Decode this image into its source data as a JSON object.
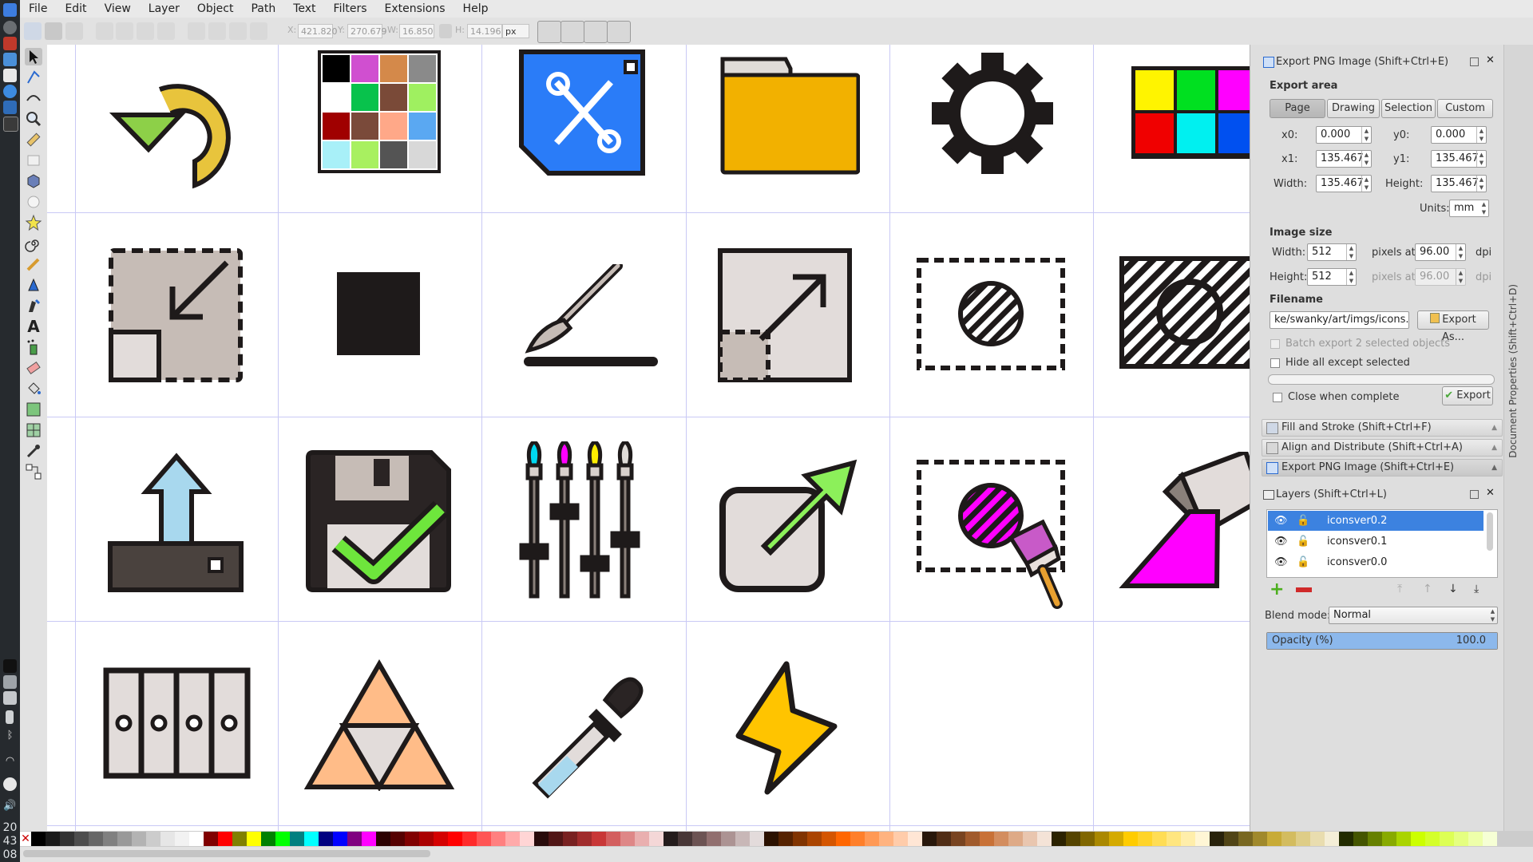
{
  "clock": {
    "line1": "20",
    "line2": "43",
    "line3": "08"
  },
  "menu": [
    "File",
    "Edit",
    "View",
    "Layer",
    "Object",
    "Path",
    "Text",
    "Filters",
    "Extensions",
    "Help"
  ],
  "toolbar": {
    "x_label": "X:",
    "x_value": "421.820",
    "y_label": "Y:",
    "y_value": "270.679",
    "w_label": "W:",
    "w_value": "16.850",
    "h_label": "H:",
    "h_value": "14.196",
    "unit": "px"
  },
  "tools": [
    "selector-tool",
    "node-tool",
    "tweak-tool",
    "zoom-tool",
    "measure-tool",
    "rectangle-tool",
    "3d-box-tool",
    "ellipse-tool",
    "star-tool",
    "spiral-tool",
    "pencil-tool",
    "pen-tool",
    "calligraphy-tool",
    "text-tool",
    "spray-tool",
    "eraser-tool",
    "paint-bucket-tool",
    "gradient-tool",
    "mesh-tool",
    "dropper-tool",
    "connector-tool"
  ],
  "canvas": {
    "icons": [
      "undo-arrow-icon",
      "swatch-grid-icon",
      "tools-document-icon",
      "folder-icon",
      "gear-icon",
      "color-palette-icon",
      "scale-down-icon",
      "filled-square-icon",
      "paintbrush-line-icon",
      "scale-up-icon",
      "hatched-selection-icon",
      "hatched-rectangle-icon",
      "upload-tray-icon",
      "save-check-icon",
      "brush-sliders-icon",
      "external-link-icon",
      "paint-selection-icon",
      "paint-bucket-pour-icon",
      "columns-icon",
      "triangle-icon",
      "eyedropper-icon",
      "lightning-icon"
    ]
  },
  "export": {
    "title": "Export PNG Image (Shift+Ctrl+E)",
    "area_heading": "Export area",
    "area_buttons": [
      "Page",
      "Drawing",
      "Selection",
      "Custom"
    ],
    "active_area": "Page",
    "x0_label": "x0:",
    "x0": "0.000",
    "y0_label": "y0:",
    "y0": "0.000",
    "x1_label": "x1:",
    "x1": "135.467",
    "y1_label": "y1:",
    "y1": "135.467",
    "width_label": "Width:",
    "width": "135.467",
    "height_label": "Height:",
    "height": "135.467",
    "units_label": "Units:",
    "units": "mm",
    "image_size_heading": "Image size",
    "img_width_label": "Width:",
    "img_width": "512",
    "img_height_label": "Height:",
    "img_height": "512",
    "pixels_at": "pixels at",
    "dpi_x": "96.00",
    "dpi_y": "96.00",
    "dpi_unit": "dpi",
    "filename_heading": "Filename",
    "filename": "ke/swanky/art/imgs/icons.png",
    "export_as": "Export As...",
    "batch_label": "Batch export 2 selected objects",
    "hide_label": "Hide all except selected",
    "close_label": "Close when complete",
    "export_button": "Export"
  },
  "dock_expanders": [
    "Fill and Stroke (Shift+Ctrl+F)",
    "Align and Distribute (Shift+Ctrl+A)",
    "Export PNG Image (Shift+Ctrl+E)"
  ],
  "layers": {
    "title": "Layers (Shift+Ctrl+L)",
    "items": [
      "iconsver0.2",
      "iconsver0.1",
      "iconsver0.0"
    ],
    "selected": "iconsver0.2",
    "blend_label": "Blend mode:",
    "blend_value": "Normal",
    "opacity_label": "Opacity (%)",
    "opacity_value": "100.0",
    "opacity_fraction": 1.0
  },
  "side_tab": "Document Properties (Shift+Ctrl+D)",
  "palette_colors": [
    "#000000",
    "#1a1a1a",
    "#333333",
    "#4d4d4d",
    "#666666",
    "#808080",
    "#999999",
    "#b3b3b3",
    "#cccccc",
    "#e6e6e6",
    "#f2f2f2",
    "#ffffff",
    "#800000",
    "#ff0000",
    "#808000",
    "#ffff00",
    "#008000",
    "#00ff00",
    "#008080",
    "#00ffff",
    "#000080",
    "#0000ff",
    "#800080",
    "#ff00ff",
    "#2b0000",
    "#550000",
    "#800000",
    "#aa0000",
    "#d40000",
    "#ff0000",
    "#ff2a2a",
    "#ff5555",
    "#ff8080",
    "#ffaaaa",
    "#ffd5d5",
    "#280b0b",
    "#501616",
    "#782121",
    "#a02c2c",
    "#c83737",
    "#d35f5f",
    "#de8787",
    "#e9afaf",
    "#f4d7d7",
    "#241c1c",
    "#483737",
    "#6c5353",
    "#916f6f",
    "#ac9393",
    "#c8b7b7",
    "#e3dbdb",
    "#2b1100",
    "#552200",
    "#803300",
    "#aa4400",
    "#d45500",
    "#ff6600",
    "#ff7f2a",
    "#ff9955",
    "#ffb380",
    "#ffccaa",
    "#ffe6d5",
    "#28170b",
    "#502d16",
    "#784421",
    "#a05a2c",
    "#c87137",
    "#d38d5f",
    "#deaa87",
    "#e9c6af",
    "#f4e3d7",
    "#2b2200",
    "#554400",
    "#806600",
    "#aa8800",
    "#d4aa00",
    "#ffcc00",
    "#ffd42a",
    "#ffdd55",
    "#ffe680",
    "#ffeeaa",
    "#fff6d5",
    "#28220b",
    "#504416",
    "#786721",
    "#a0892c",
    "#c8ab37",
    "#d3bc5f",
    "#decd87",
    "#e9ddaf",
    "#f4eed7",
    "#222b00",
    "#445500",
    "#668000",
    "#88aa00",
    "#aad400",
    "#ccff00",
    "#d4ff2a",
    "#ddff55",
    "#e5ff80",
    "#eeffaa",
    "#f6ffd5"
  ]
}
